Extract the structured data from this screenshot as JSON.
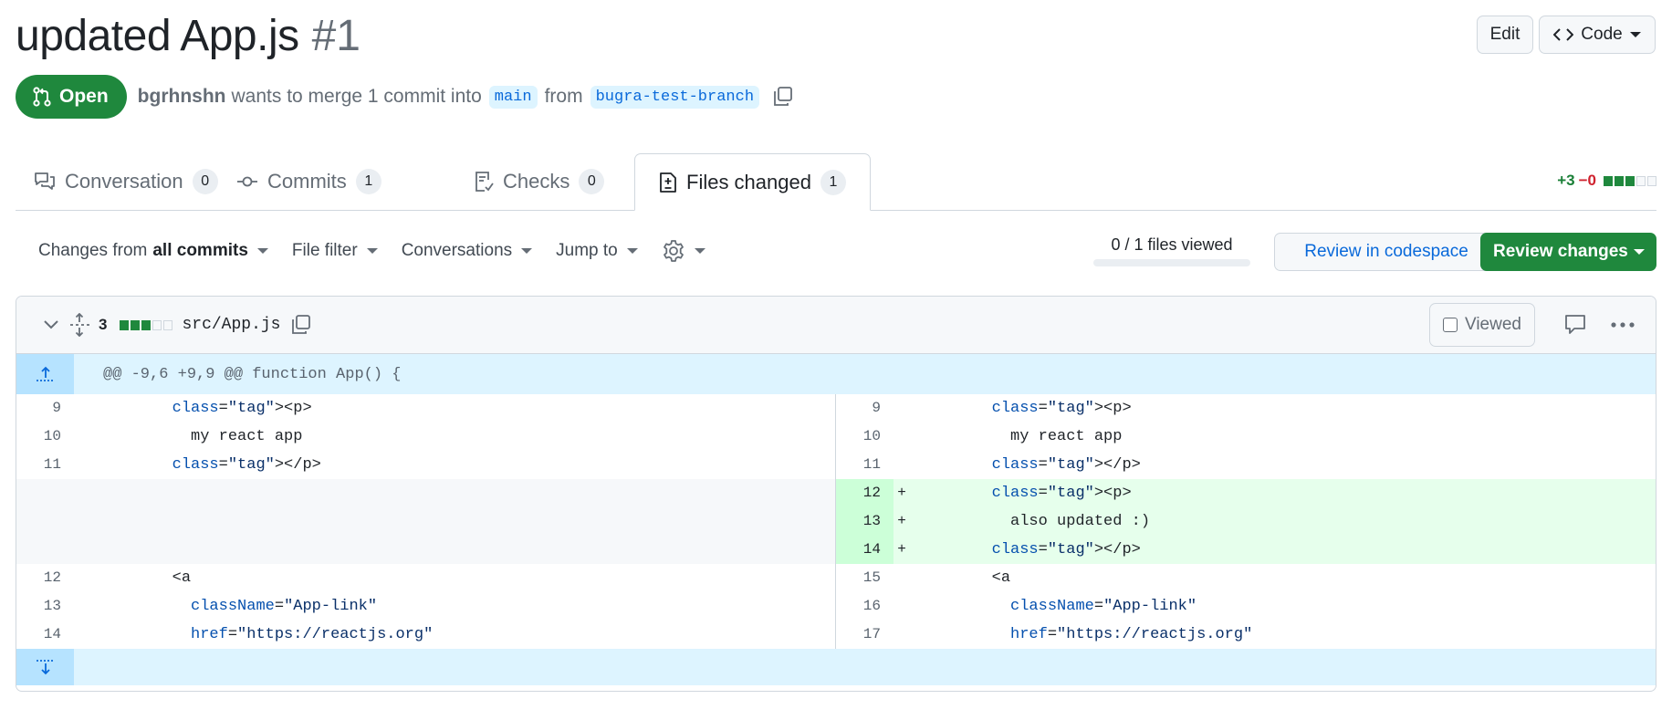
{
  "pr": {
    "title": "updated App.js",
    "number": "#1",
    "state": "Open",
    "author": "bgrhnshn",
    "merge_text": "wants to merge 1 commit into",
    "base_branch": "main",
    "from_text": "from",
    "head_branch": "bugra-test-branch"
  },
  "header_buttons": {
    "edit": "Edit",
    "code": "Code"
  },
  "tabs": [
    {
      "label": "Conversation",
      "count": "0"
    },
    {
      "label": "Commits",
      "count": "1"
    },
    {
      "label": "Checks",
      "count": "0"
    },
    {
      "label": "Files changed",
      "count": "1"
    }
  ],
  "diffstat": {
    "additions": "+3",
    "deletions": "−0"
  },
  "toolbar": {
    "changes_from": "Changes from",
    "all_commits": "all commits",
    "file_filter": "File filter",
    "conversations": "Conversations",
    "jump_to": "Jump to",
    "files_viewed": "0 / 1 files viewed",
    "review_codespace": "Review in codespace",
    "review_changes": "Review changes"
  },
  "file": {
    "change_count": "3",
    "path": "src/App.js",
    "viewed_label": "Viewed",
    "hunk_header": "@@ -9,6 +9,9 @@ function App() {"
  },
  "diff_rows": [
    {
      "l_num": "9",
      "l_code": "        <p>",
      "r_num": "9",
      "r_code": "        <p>",
      "type": "context"
    },
    {
      "l_num": "10",
      "l_code": "          my react app",
      "r_num": "10",
      "r_code": "          my react app",
      "type": "context"
    },
    {
      "l_num": "11",
      "l_code": "        </p>",
      "r_num": "11",
      "r_code": "        </p>",
      "type": "context"
    },
    {
      "l_num": "",
      "l_code": "",
      "r_num": "12",
      "r_code": "        <p>",
      "type": "added"
    },
    {
      "l_num": "",
      "l_code": "",
      "r_num": "13",
      "r_code": "          also updated :)",
      "type": "added"
    },
    {
      "l_num": "",
      "l_code": "",
      "r_num": "14",
      "r_code": "        </p>",
      "type": "added"
    },
    {
      "l_num": "12",
      "l_code": "        <a",
      "r_num": "15",
      "r_code": "        <a",
      "type": "context"
    },
    {
      "l_num": "13",
      "l_code": "          className=\"App-link\"",
      "r_num": "16",
      "r_code": "          className=\"App-link\"",
      "type": "context"
    },
    {
      "l_num": "14",
      "l_code": "          href=\"https://reactjs.org\"",
      "r_num": "17",
      "r_code": "          href=\"https://reactjs.org\"",
      "type": "context"
    }
  ],
  "colors": {
    "open_green": "#1f883d",
    "link_blue": "#0969da",
    "hunk_bg": "#ddf4ff",
    "added_bg": "#e6ffec",
    "added_num_bg": "#ccffd8"
  }
}
